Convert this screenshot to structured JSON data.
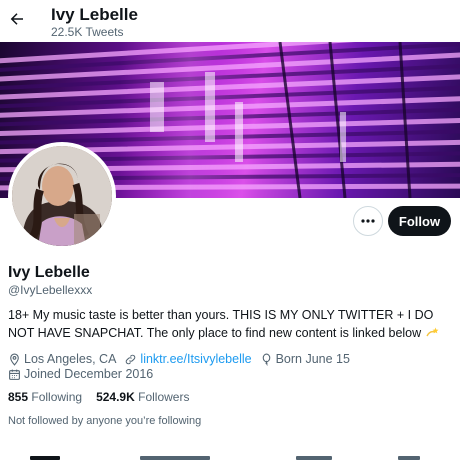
{
  "header": {
    "name": "Ivy Lebelle",
    "tweet_count": "22.5K Tweets"
  },
  "profile": {
    "display_name": "Ivy Lebelle",
    "handle": "@IvyLebellexxx",
    "bio": "18+ My music taste is better than yours. THIS IS MY ONLY TWITTER + I DO NOT HAVE SNAPCHAT. The only place to find new content is linked below",
    "location": "Los Angeles, CA",
    "website": "linktr.ee/Itsivylebelle",
    "born": "Born June 15",
    "joined": "Joined December 2016",
    "following_count": "855",
    "following_label": "Following",
    "followers_count": "524.9K",
    "followers_label": "Followers",
    "not_followed_text": "Not followed by anyone you’re following"
  },
  "actions": {
    "follow_label": "Follow"
  },
  "icons": {
    "back": "arrow-left-icon",
    "more": "more-dots-icon",
    "location": "location-pin-icon",
    "link": "link-icon",
    "birthday": "balloon-icon",
    "calendar": "calendar-icon",
    "bio_emoji": "dizzy-star-emoji"
  },
  "colors": {
    "link": "#1d9bf0",
    "secondary_text": "#536471",
    "primary_text": "#0f1419",
    "follow_button": "#0f1419"
  }
}
